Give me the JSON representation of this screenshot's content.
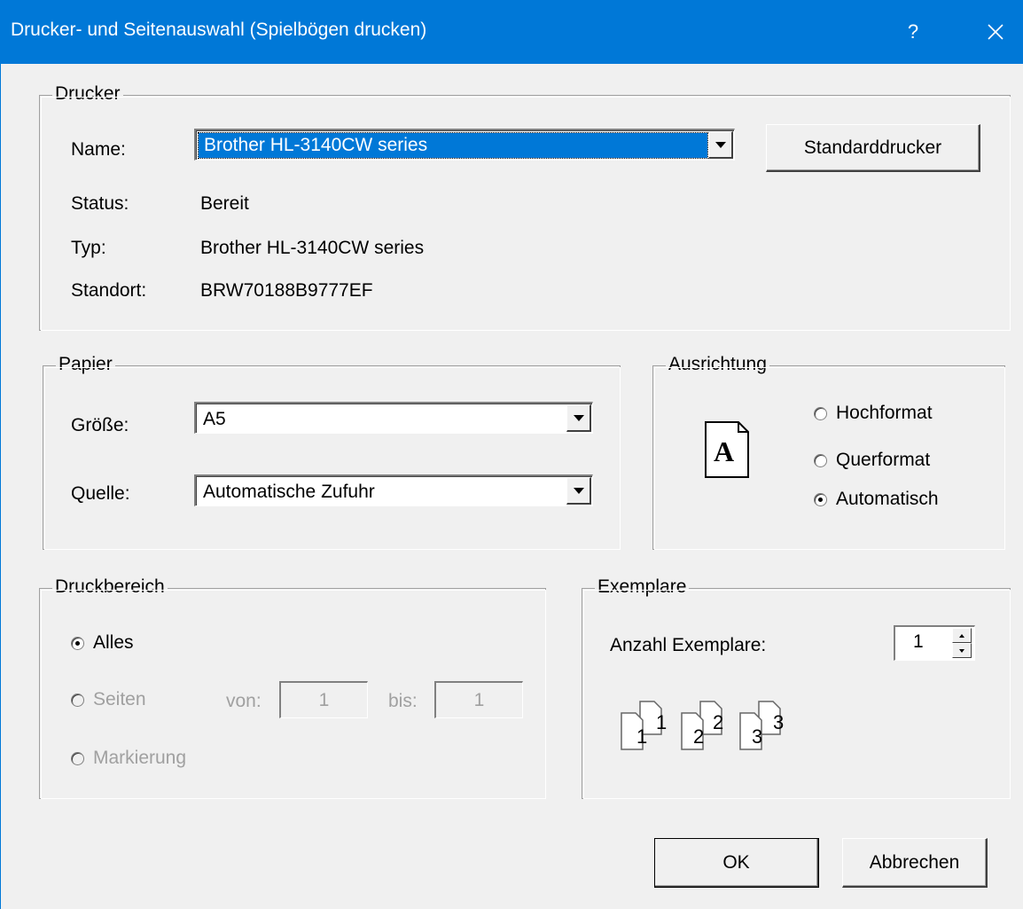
{
  "window": {
    "title": "Drucker- und Seitenauswahl (Spielbögen drucken)",
    "help_label": "?",
    "close_icon": "close-icon"
  },
  "printer": {
    "legend": "Drucker",
    "name_label": "Name:",
    "name_value": "Brother HL-3140CW series",
    "default_button": "Standarddrucker",
    "status_label": "Status:",
    "status_value": "Bereit",
    "type_label": "Typ:",
    "type_value": "Brother HL-3140CW series",
    "location_label": "Standort:",
    "location_value": "BRW70188B9777EF"
  },
  "paper": {
    "legend": "Papier",
    "size_label": "Größe:",
    "size_value": "A5",
    "source_label": "Quelle:",
    "source_value": "Automatische Zufuhr"
  },
  "orientation": {
    "legend": "Ausrichtung",
    "icon_letter": "A",
    "options": [
      {
        "label": "Hochformat",
        "checked": false
      },
      {
        "label": "Querformat",
        "checked": false
      },
      {
        "label": "Automatisch",
        "checked": true
      }
    ]
  },
  "print_range": {
    "legend": "Druckbereich",
    "all_label": "Alles",
    "pages_label": "Seiten",
    "from_label": "von:",
    "from_value": "1",
    "to_label": "bis:",
    "to_value": "1",
    "selection_label": "Markierung"
  },
  "copies": {
    "legend": "Exemplare",
    "count_label": "Anzahl Exemplare:",
    "count_value": "1",
    "collate_icons": [
      {
        "back": "1",
        "front": "1"
      },
      {
        "back": "2",
        "front": "2"
      },
      {
        "back": "3",
        "front": "3"
      }
    ]
  },
  "actions": {
    "ok_label": "OK",
    "cancel_label": "Abbrechen"
  }
}
